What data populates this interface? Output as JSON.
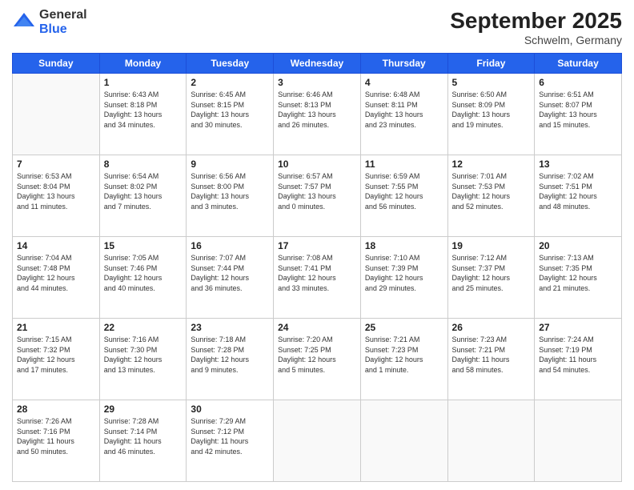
{
  "header": {
    "logo_general": "General",
    "logo_blue": "Blue",
    "month_title": "September 2025",
    "subtitle": "Schwelm, Germany"
  },
  "weekdays": [
    "Sunday",
    "Monday",
    "Tuesday",
    "Wednesday",
    "Thursday",
    "Friday",
    "Saturday"
  ],
  "weeks": [
    [
      {
        "day": "",
        "info": ""
      },
      {
        "day": "1",
        "info": "Sunrise: 6:43 AM\nSunset: 8:18 PM\nDaylight: 13 hours\nand 34 minutes."
      },
      {
        "day": "2",
        "info": "Sunrise: 6:45 AM\nSunset: 8:15 PM\nDaylight: 13 hours\nand 30 minutes."
      },
      {
        "day": "3",
        "info": "Sunrise: 6:46 AM\nSunset: 8:13 PM\nDaylight: 13 hours\nand 26 minutes."
      },
      {
        "day": "4",
        "info": "Sunrise: 6:48 AM\nSunset: 8:11 PM\nDaylight: 13 hours\nand 23 minutes."
      },
      {
        "day": "5",
        "info": "Sunrise: 6:50 AM\nSunset: 8:09 PM\nDaylight: 13 hours\nand 19 minutes."
      },
      {
        "day": "6",
        "info": "Sunrise: 6:51 AM\nSunset: 8:07 PM\nDaylight: 13 hours\nand 15 minutes."
      }
    ],
    [
      {
        "day": "7",
        "info": "Sunrise: 6:53 AM\nSunset: 8:04 PM\nDaylight: 13 hours\nand 11 minutes."
      },
      {
        "day": "8",
        "info": "Sunrise: 6:54 AM\nSunset: 8:02 PM\nDaylight: 13 hours\nand 7 minutes."
      },
      {
        "day": "9",
        "info": "Sunrise: 6:56 AM\nSunset: 8:00 PM\nDaylight: 13 hours\nand 3 minutes."
      },
      {
        "day": "10",
        "info": "Sunrise: 6:57 AM\nSunset: 7:57 PM\nDaylight: 13 hours\nand 0 minutes."
      },
      {
        "day": "11",
        "info": "Sunrise: 6:59 AM\nSunset: 7:55 PM\nDaylight: 12 hours\nand 56 minutes."
      },
      {
        "day": "12",
        "info": "Sunrise: 7:01 AM\nSunset: 7:53 PM\nDaylight: 12 hours\nand 52 minutes."
      },
      {
        "day": "13",
        "info": "Sunrise: 7:02 AM\nSunset: 7:51 PM\nDaylight: 12 hours\nand 48 minutes."
      }
    ],
    [
      {
        "day": "14",
        "info": "Sunrise: 7:04 AM\nSunset: 7:48 PM\nDaylight: 12 hours\nand 44 minutes."
      },
      {
        "day": "15",
        "info": "Sunrise: 7:05 AM\nSunset: 7:46 PM\nDaylight: 12 hours\nand 40 minutes."
      },
      {
        "day": "16",
        "info": "Sunrise: 7:07 AM\nSunset: 7:44 PM\nDaylight: 12 hours\nand 36 minutes."
      },
      {
        "day": "17",
        "info": "Sunrise: 7:08 AM\nSunset: 7:41 PM\nDaylight: 12 hours\nand 33 minutes."
      },
      {
        "day": "18",
        "info": "Sunrise: 7:10 AM\nSunset: 7:39 PM\nDaylight: 12 hours\nand 29 minutes."
      },
      {
        "day": "19",
        "info": "Sunrise: 7:12 AM\nSunset: 7:37 PM\nDaylight: 12 hours\nand 25 minutes."
      },
      {
        "day": "20",
        "info": "Sunrise: 7:13 AM\nSunset: 7:35 PM\nDaylight: 12 hours\nand 21 minutes."
      }
    ],
    [
      {
        "day": "21",
        "info": "Sunrise: 7:15 AM\nSunset: 7:32 PM\nDaylight: 12 hours\nand 17 minutes."
      },
      {
        "day": "22",
        "info": "Sunrise: 7:16 AM\nSunset: 7:30 PM\nDaylight: 12 hours\nand 13 minutes."
      },
      {
        "day": "23",
        "info": "Sunrise: 7:18 AM\nSunset: 7:28 PM\nDaylight: 12 hours\nand 9 minutes."
      },
      {
        "day": "24",
        "info": "Sunrise: 7:20 AM\nSunset: 7:25 PM\nDaylight: 12 hours\nand 5 minutes."
      },
      {
        "day": "25",
        "info": "Sunrise: 7:21 AM\nSunset: 7:23 PM\nDaylight: 12 hours\nand 1 minute."
      },
      {
        "day": "26",
        "info": "Sunrise: 7:23 AM\nSunset: 7:21 PM\nDaylight: 11 hours\nand 58 minutes."
      },
      {
        "day": "27",
        "info": "Sunrise: 7:24 AM\nSunset: 7:19 PM\nDaylight: 11 hours\nand 54 minutes."
      }
    ],
    [
      {
        "day": "28",
        "info": "Sunrise: 7:26 AM\nSunset: 7:16 PM\nDaylight: 11 hours\nand 50 minutes."
      },
      {
        "day": "29",
        "info": "Sunrise: 7:28 AM\nSunset: 7:14 PM\nDaylight: 11 hours\nand 46 minutes."
      },
      {
        "day": "30",
        "info": "Sunrise: 7:29 AM\nSunset: 7:12 PM\nDaylight: 11 hours\nand 42 minutes."
      },
      {
        "day": "",
        "info": ""
      },
      {
        "day": "",
        "info": ""
      },
      {
        "day": "",
        "info": ""
      },
      {
        "day": "",
        "info": ""
      }
    ]
  ]
}
